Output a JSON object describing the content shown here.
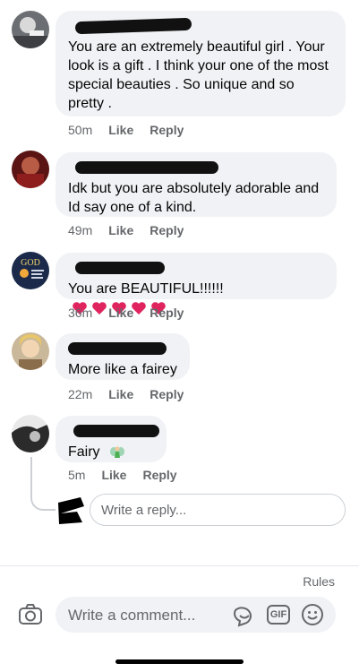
{
  "comments": [
    {
      "text": "You are an extremely beautiful girl . Your look is a gift . I think your one of the most special beauties . So unique and so pretty .",
      "time": "50m",
      "like": "Like",
      "reply": "Reply"
    },
    {
      "text": "Idk but you are absolutely adorable and Id say one of a kind.",
      "time": "49m",
      "like": "Like",
      "reply": "Reply"
    },
    {
      "text": "You are BEAUTIFUL!!!!!!",
      "time": "36m",
      "like": "Like",
      "reply": "Reply",
      "avatar_text": "GOD"
    },
    {
      "text": "More like a fairey",
      "time": "22m",
      "like": "Like",
      "reply": "Reply"
    },
    {
      "text": "Fairy",
      "time": "5m",
      "like": "Like",
      "reply": "Reply"
    }
  ],
  "reply_box": {
    "placeholder": "Write a reply..."
  },
  "footer": {
    "rules": "Rules",
    "composer_placeholder": "Write a comment...",
    "gif_label": "GIF"
  },
  "colors": {
    "heart": "#e0245e",
    "bubble": "#f0f2f5",
    "meta": "#65676b"
  }
}
